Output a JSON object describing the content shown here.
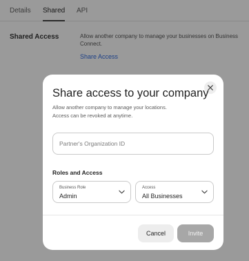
{
  "tabs": [
    "Details",
    "Shared",
    "API"
  ],
  "background": {
    "section_label": "Shared Access",
    "description": "Allow another company to manage your businesses on Business Connect.",
    "link": "Share Access"
  },
  "modal": {
    "title": "Share access to your company",
    "description_line1": "Allow another company to manage your locations.",
    "description_line2": "Access can be revoked at anytime.",
    "org_input_placeholder": "Partner's Organization ID",
    "roles_section_title": "Roles and Access",
    "business_role": {
      "label": "Business Role",
      "value": "Admin"
    },
    "access": {
      "label": "Access",
      "value": "All Businesses"
    },
    "cancel_label": "Cancel",
    "invite_label": "Invite"
  }
}
